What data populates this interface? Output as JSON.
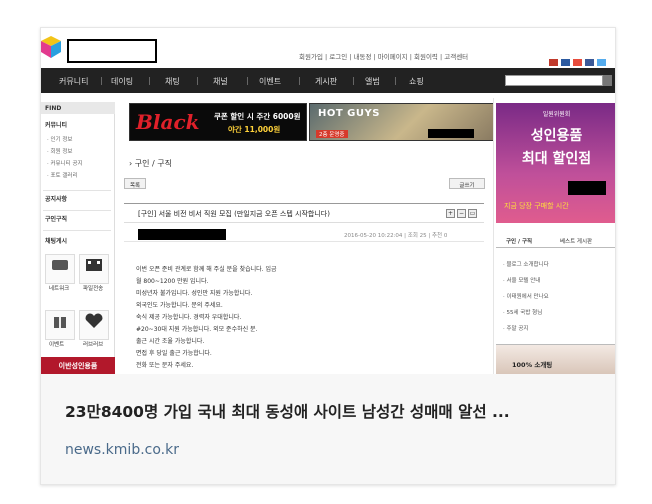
{
  "card": {
    "title": "23만8400명 가입 국내 최대 동성애 사이트 남성간 성매매 알선 ...",
    "source": "news.kmib.co.kr"
  },
  "screenshot": {
    "top_links": "회원가입 | 로그인 | 내동정 | 마이페이지 | 회원이력 | 고객센터",
    "nav": [
      "커뮤니티",
      "데이팅",
      "채팅",
      "채널",
      "이벤트",
      "게시판",
      "앨범",
      "쇼핑"
    ],
    "left": {
      "find_label": "FIND",
      "section1_head": "커뮤니티",
      "section1_items": [
        "· 인기 정보",
        "· 회원 정보",
        "· 커뮤니티 공지",
        "· 포토 갤러리"
      ],
      "section2_head": "공지사항",
      "section3_head": "구인구직",
      "section4_head": "채팅게시",
      "tiles": [
        "네트워크",
        "파일전송",
        "이벤트",
        "러브러브"
      ],
      "ad_label": "이반성인용품"
    },
    "banner_black": {
      "word": "Black",
      "line1": "쿠폰 할인 시 주간 6000원",
      "line2": "야간 11,000원"
    },
    "banner_hotguys": {
      "text": "HOT GUYS",
      "sub": "2층 운영중"
    },
    "breadcrumb": "› 구인 / 구직",
    "list_btn": "목록",
    "write_btn": "글쓰기",
    "post_title": "[구인] 서울 비전 비서 직원 모집 (만일지금 오픈 스텝 시작합니다)",
    "post_meta": "2016-05-20 10:22:04  |  조회 25  |  추천 0",
    "body_lines": [
      "이번 오픈 준비 관계로 함께 해 주실 분을 찾습니다. 입금",
      "월 800~1200 만원 입니다.",
      "미성년자 불가입니다. 성인만 지원 가능합니다.",
      "외국인도 가능합니다. 문의 주세요.",
      "숙식 제공 가능합니다. 경력자 우대합니다.",
      "#20~30대 지원 가능합니다. 외모 준수하신 분.",
      "출근 시간 조율 가능합니다.",
      "면접 후 당일 출근 가능합니다.",
      "전화 또는 문자 주세요."
    ],
    "right_banner": {
      "top": "일원위원회",
      "line1": "성인용품",
      "line2": "최대 할인점",
      "bottom": "지금 당장 구매할 시간"
    },
    "right_tabs": [
      "구인 / 구직",
      "베스트 게시판"
    ],
    "right_list": [
      "· 블로그 소개합니다",
      "· 서울 모텔 안내",
      "· 이태원에서 만나요",
      "· 55세 국밥 형님",
      "· 주말 공지"
    ],
    "right_bottom": "100% 소개팅"
  },
  "colors": {
    "nav_bg": "#222222",
    "ad_red": "#b2182b",
    "banner_red": "#e0202a",
    "banner_purple": "#7a2a86",
    "source_link": "#4a6a8a"
  }
}
